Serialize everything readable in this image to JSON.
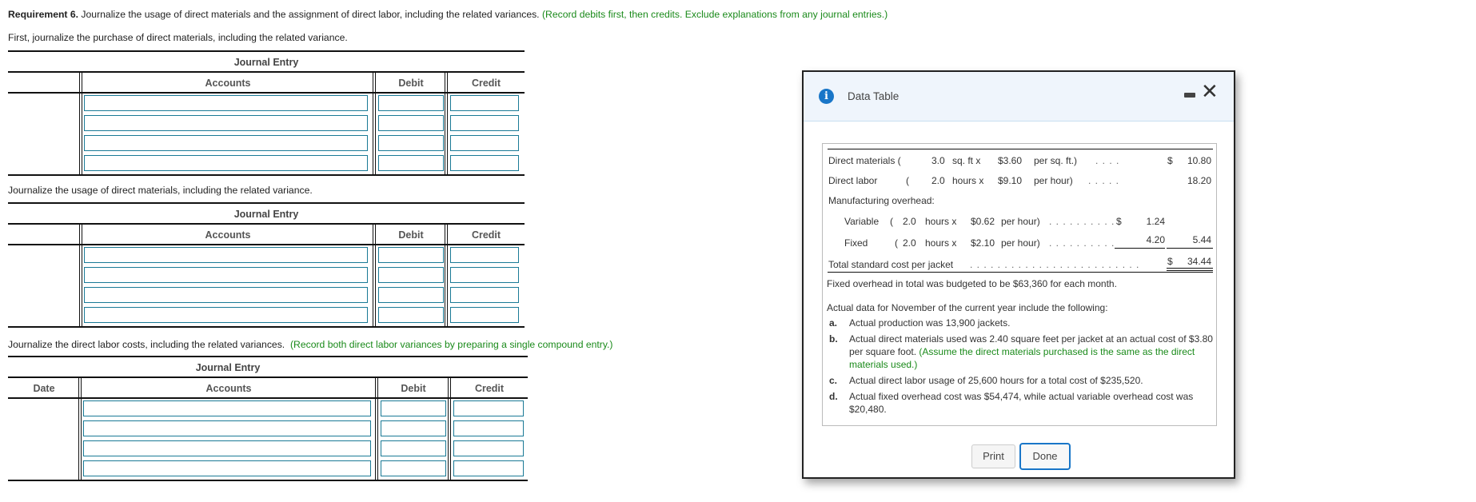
{
  "instructions": {
    "requirement_label": "Requirement 6.",
    "requirement_text": " Journalize the usage of direct materials and the assignment of direct labor, including the related variances.",
    "requirement_note": "(Record debits first, then credits. Exclude explanations from any journal entries.)",
    "section1": "First, journalize the purchase of direct materials, including the related variance.",
    "section2": "Journalize the usage of direct materials, including the related variance.",
    "section3": "Journalize the direct labor costs, including the related variances.",
    "section3_note": "(Record both direct labor variances by preparing a single compound entry.)"
  },
  "journal_tables": [
    {
      "title": "Journal Entry",
      "columns": {
        "date": "",
        "accounts": "Accounts",
        "debit": "Debit",
        "credit": "Credit"
      },
      "rows": [
        {
          "account": "",
          "debit": "",
          "credit": ""
        },
        {
          "account": "",
          "debit": "",
          "credit": ""
        },
        {
          "account": "",
          "debit": "",
          "credit": ""
        },
        {
          "account": "",
          "debit": "",
          "credit": ""
        }
      ]
    },
    {
      "title": "Journal Entry",
      "columns": {
        "date": "",
        "accounts": "Accounts",
        "debit": "Debit",
        "credit": "Credit"
      },
      "rows": [
        {
          "account": "",
          "debit": "",
          "credit": ""
        },
        {
          "account": "",
          "debit": "",
          "credit": ""
        },
        {
          "account": "",
          "debit": "",
          "credit": ""
        },
        {
          "account": "",
          "debit": "",
          "credit": ""
        }
      ]
    },
    {
      "title": "Journal Entry",
      "columns": {
        "date": "Date",
        "accounts": "Accounts",
        "debit": "Debit",
        "credit": "Credit"
      },
      "rows": [
        {
          "account": "",
          "debit": "",
          "credit": ""
        },
        {
          "account": "",
          "debit": "",
          "credit": ""
        },
        {
          "account": "",
          "debit": "",
          "credit": ""
        },
        {
          "account": "",
          "debit": "",
          "credit": ""
        }
      ]
    }
  ],
  "modal": {
    "title": "Data Table",
    "icons": {
      "info": "info-icon",
      "minimize": "minimize-icon",
      "close": "close-icon"
    },
    "close_glyph": "✕",
    "info_glyph": "i",
    "standard_cost": {
      "dm": {
        "label": "Direct materials (",
        "qty": "3.0",
        "unit": "sq. ft x",
        "rate": "$3.60",
        "per": "per sq. ft.)",
        "dots": ". . . .",
        "dollar": "$",
        "amount": "10.80"
      },
      "dl": {
        "label": "Direct labor",
        "paren": "(",
        "qty": "2.0",
        "unit": "hours x",
        "rate": "$9.10",
        "per": "per hour)",
        "dots": ". . . . .",
        "amount": "18.20"
      },
      "moh_label": "Manufacturing overhead:",
      "var": {
        "label": "Variable",
        "paren": "(",
        "qty": "2.0",
        "unit": "hours x",
        "rate": "$0.62",
        "per": "per hour)",
        "dots": ". . . . . . . . . .",
        "dollar": "$",
        "amount": "1.24"
      },
      "fix": {
        "label": "Fixed",
        "paren": "(",
        "qty": "2.0",
        "unit": "hours x",
        "rate": "$2.10",
        "per": "per hour)",
        "dots": ". . . . . . . . . .",
        "amount": "4.20",
        "subtotal": "5.44"
      },
      "total": {
        "label": "Total standard cost per jacket",
        "dots": ". . . . . . . . . . . . . . . . . . . . . . . . .",
        "dollar": "$",
        "amount": "34.44"
      }
    },
    "fixed_overhead_note": "Fixed overhead in total was budgeted to be $63,360 for each month.",
    "actual_intro": "Actual data for November of the current year include the following:",
    "actual_items": [
      {
        "label": "a.",
        "text": "Actual production was 13,900 jackets."
      },
      {
        "label": "b.",
        "text": "Actual direct materials used was 2.40 square feet per jacket at an actual cost of $3.80 per square foot.",
        "note": "(Assume the direct materials purchased is the same as the direct materials used.)"
      },
      {
        "label": "c.",
        "text": "Actual direct labor usage of 25,600 hours for a total cost of $235,520."
      },
      {
        "label": "d.",
        "text": "Actual fixed overhead cost was $54,474, while actual variable overhead cost was $20,480."
      }
    ],
    "buttons": {
      "print": "Print",
      "done": "Done"
    }
  }
}
